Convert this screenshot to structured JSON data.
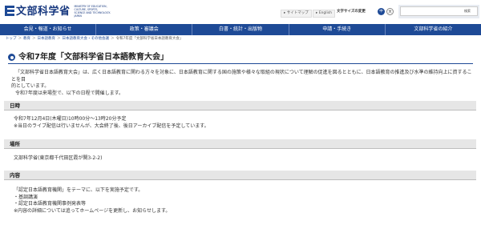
{
  "header": {
    "logo_title": "文部科学省",
    "logo_sub_lines": [
      "MINISTRY OF EDUCATION,",
      "CULTURE, SPORTS,",
      "SCIENCE AND TECHNOLOGY-JAPAN"
    ],
    "util_links": [
      "サイトマップ",
      "English"
    ],
    "fontsize_label": "文字サイズの変更",
    "fontsize_buttons": [
      "中",
      "大"
    ],
    "search_placeholder": "",
    "search_button": "検索"
  },
  "nav": {
    "items": [
      "会見・報道・お知らせ",
      "政策・審議会",
      "白書・統計・出版物",
      "申請・手続き",
      "文部科学省の紹介"
    ]
  },
  "breadcrumb": {
    "items": [
      "トップ",
      "教育",
      "日本語教育",
      "日本語教育大会・その他会議"
    ],
    "current": "令和7年度「文部科学省日本語教育大会」"
  },
  "page": {
    "title": "令和7年度「文部科学省日本語教育大会」",
    "intro_lines": [
      "「文部科学省日本語教育大会」は、広く日本語教育に関わる方々を対象に、日本語教育に関する国の施策や様々な取組の現状について理解の促進を図るとともに、日本語教育の推進及び水準の維持向上に資することを目",
      "的としています。"
    ],
    "intro_note": "令和7年度は来場型で、以下の日程で開催します。"
  },
  "sections": {
    "date": {
      "heading": "日時",
      "lines": [
        "令和7年12月4日(木曜日)10時00分～13時20分予定",
        "※当日のライブ配信は行いませんが、大会終了後、後日アーカイブ配信を予定しています。"
      ]
    },
    "place": {
      "heading": "場所",
      "lines": [
        "文部科学省(東京都千代田区霞が関3-2-2)"
      ]
    },
    "content": {
      "heading": "内容",
      "lines": [
        "「認定日本語教育機関」をテーマに、以下を実施予定です。",
        "・基調講演",
        "・認定日本語教育機関事例発表等",
        "※内容の詳細については追ってホームページを更新し、お知らせします。"
      ]
    }
  },
  "colors": {
    "brand_blue": "#1e4a96",
    "section_bg": "#e6e6e6"
  }
}
